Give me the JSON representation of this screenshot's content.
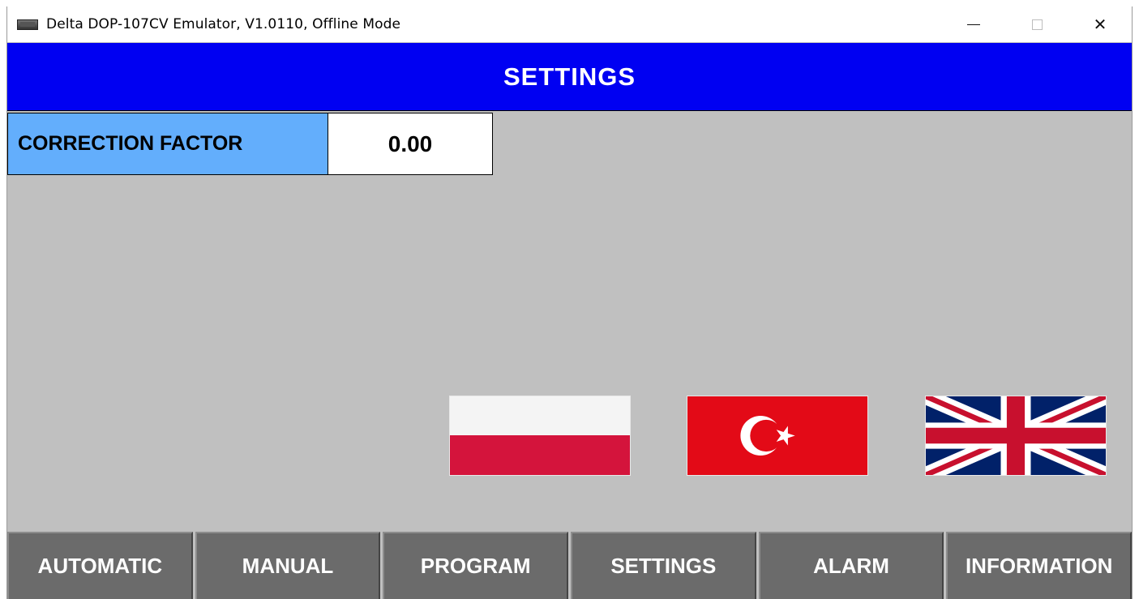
{
  "window": {
    "title": "Delta DOP-107CV Emulator, V1.0110, Offline Mode",
    "controls": {
      "minimize": "minimize-icon",
      "maximize": "maximize-icon",
      "close": "✕"
    }
  },
  "header": {
    "title": "SETTINGS"
  },
  "correction_factor": {
    "label": "CORRECTION FACTOR",
    "value": "0.00"
  },
  "languages": [
    {
      "icon": "poland-flag-icon"
    },
    {
      "icon": "turkey-flag-icon"
    },
    {
      "icon": "uk-flag-icon"
    }
  ],
  "nav": {
    "items": [
      {
        "label": "AUTOMATIC"
      },
      {
        "label": "MANUAL"
      },
      {
        "label": "PROGRAM"
      },
      {
        "label": "SETTINGS"
      },
      {
        "label": "ALARM"
      },
      {
        "label": "INFORMATION"
      }
    ]
  },
  "colors": {
    "header_bg": "#0000f2",
    "label_bg": "#63aefc",
    "panel_bg": "#c0c0c0",
    "nav_bg": "#6b6b6b"
  }
}
